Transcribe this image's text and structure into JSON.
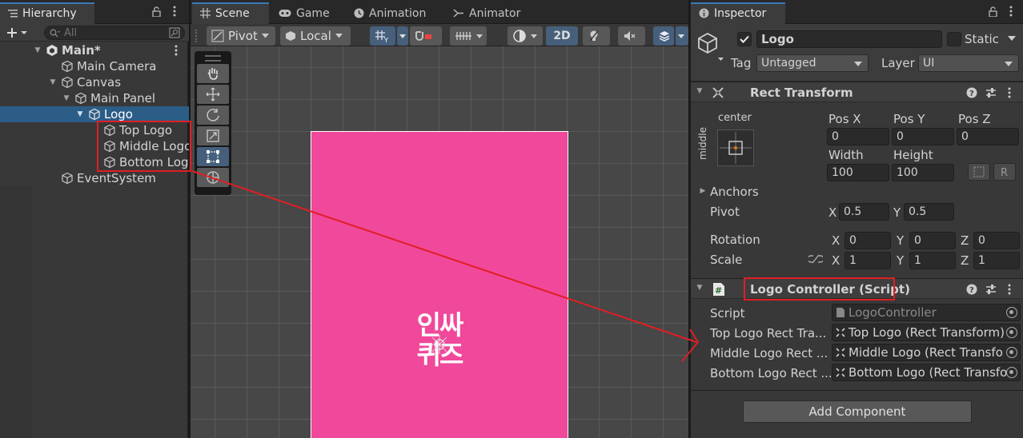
{
  "hierarchy": {
    "tab": "Hierarchy",
    "search_placeholder": "All",
    "rows": [
      {
        "label": "Main*",
        "depth": 0
      },
      {
        "label": "Main Camera",
        "depth": 1
      },
      {
        "label": "Canvas",
        "depth": 1
      },
      {
        "label": "Main Panel",
        "depth": 2
      },
      {
        "label": "Logo",
        "depth": 3
      },
      {
        "label": "Top Logo",
        "depth": 4
      },
      {
        "label": "Middle Logo",
        "depth": 4
      },
      {
        "label": "Bottom Logo",
        "depth": 4
      },
      {
        "label": "EventSystem",
        "depth": 1
      }
    ]
  },
  "scene": {
    "tabs": [
      "Scene",
      "Game",
      "Animation",
      "Animator"
    ],
    "pivot": "Pivot",
    "local": "Local",
    "mode_2d": "2D",
    "logo_line1": "인싸",
    "logo_line2": "퀴즈"
  },
  "inspector": {
    "tab": "Inspector",
    "object_name": "Logo",
    "static_label": "Static",
    "tag_label": "Tag",
    "tag_value": "Untagged",
    "layer_label": "Layer",
    "layer_value": "UI",
    "rect_transform": {
      "title": "Rect Transform",
      "anchor_h": "center",
      "anchor_v": "middle",
      "pos_x_label": "Pos X",
      "pos_x": "0",
      "pos_y_label": "Pos Y",
      "pos_y": "0",
      "pos_z_label": "Pos Z",
      "pos_z": "0",
      "width_label": "Width",
      "width": "100",
      "height_label": "Height",
      "height": "100",
      "anchors_label": "Anchors",
      "pivot_label": "Pivot",
      "pivot_x": "0.5",
      "pivot_y": "0.5",
      "rotation_label": "Rotation",
      "rot_x": "0",
      "rot_y": "0",
      "rot_z": "0",
      "scale_label": "Scale",
      "scale_x": "1",
      "scale_y": "1",
      "scale_z": "1",
      "x": "X",
      "y": "Y",
      "z": "Z"
    },
    "logo_controller": {
      "title": "Logo Controller (Script)",
      "script_label": "Script",
      "script_value": "LogoController",
      "fields": [
        {
          "label": "Top Logo Rect Tra...",
          "value": "Top Logo (Rect Transform)"
        },
        {
          "label": "Middle Logo Rect ...",
          "value": "Middle Logo (Rect Transfo"
        },
        {
          "label": "Bottom Logo Rect ...",
          "value": "Bottom Logo (Rect Transfo"
        }
      ]
    },
    "add_component": "Add Component"
  },
  "colors": {
    "panel_pink": "#f0489a",
    "selection": "#2c5d87",
    "annotation_red": "#e01e25"
  }
}
